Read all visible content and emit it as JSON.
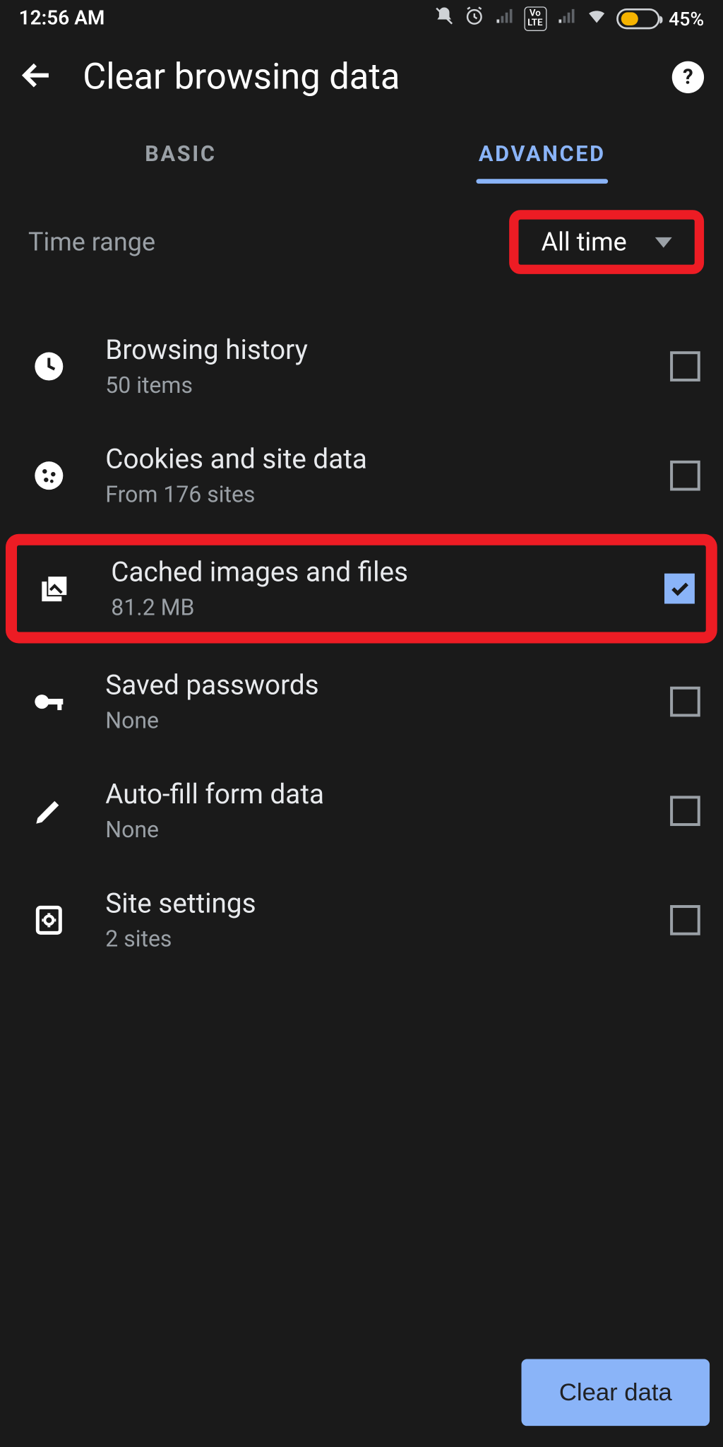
{
  "status": {
    "time": "12:56 AM",
    "battery_pct": "45%",
    "battery_fill_pct": 45
  },
  "header": {
    "title": "Clear browsing data"
  },
  "tabs": {
    "basic": "BASIC",
    "advanced": "ADVANCED",
    "active": "advanced"
  },
  "time_range": {
    "label": "Time range",
    "value": "All time"
  },
  "items": [
    {
      "id": "browsing-history",
      "title": "Browsing history",
      "sub": "50 items",
      "checked": false,
      "icon": "clock-icon"
    },
    {
      "id": "cookies",
      "title": "Cookies and site data",
      "sub": "From 176 sites",
      "checked": false,
      "icon": "cookie-icon"
    },
    {
      "id": "cached",
      "title": "Cached images and files",
      "sub": "81.2 MB",
      "checked": true,
      "icon": "images-icon",
      "highlight": true
    },
    {
      "id": "passwords",
      "title": "Saved passwords",
      "sub": "None",
      "checked": false,
      "icon": "key-icon"
    },
    {
      "id": "autofill",
      "title": "Auto-fill form data",
      "sub": "None",
      "checked": false,
      "icon": "pencil-icon"
    },
    {
      "id": "site-settings",
      "title": "Site settings",
      "sub": "2 sites",
      "checked": false,
      "icon": "gear-page-icon"
    }
  ],
  "button": {
    "clear": "Clear data"
  },
  "colors": {
    "accent": "#8ab4f8",
    "highlight": "#ed1c24",
    "bg": "#1a1a1a"
  }
}
